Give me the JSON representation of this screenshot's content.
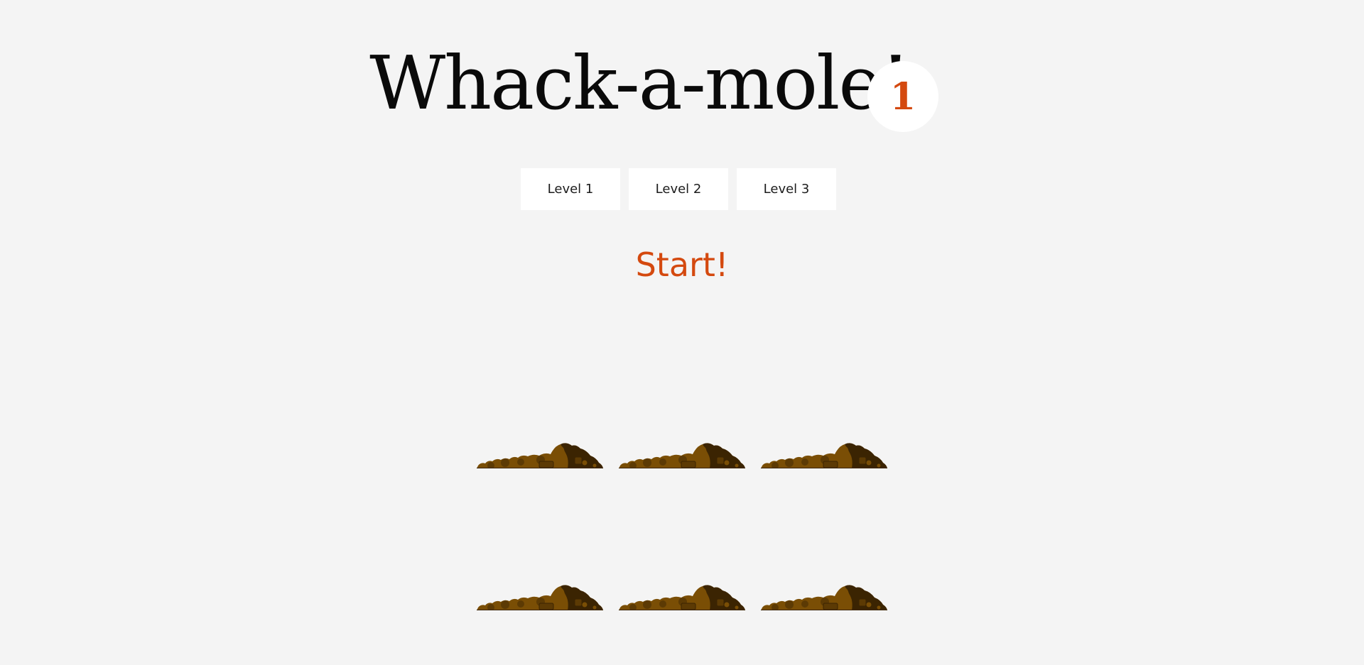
{
  "game": {
    "title": "Whack-a-mole!",
    "score": "1",
    "start_label": "Start!",
    "accent_color": "#d4490f"
  },
  "levels": [
    {
      "label": "Level 1"
    },
    {
      "label": "Level 2"
    },
    {
      "label": "Level 3"
    }
  ],
  "board": {
    "rows": 2,
    "cols": 3,
    "hole_icon": "dirt-mound-icon",
    "dirt_colors": [
      "#7a4e05",
      "#5c3a04",
      "#3b2402"
    ]
  }
}
